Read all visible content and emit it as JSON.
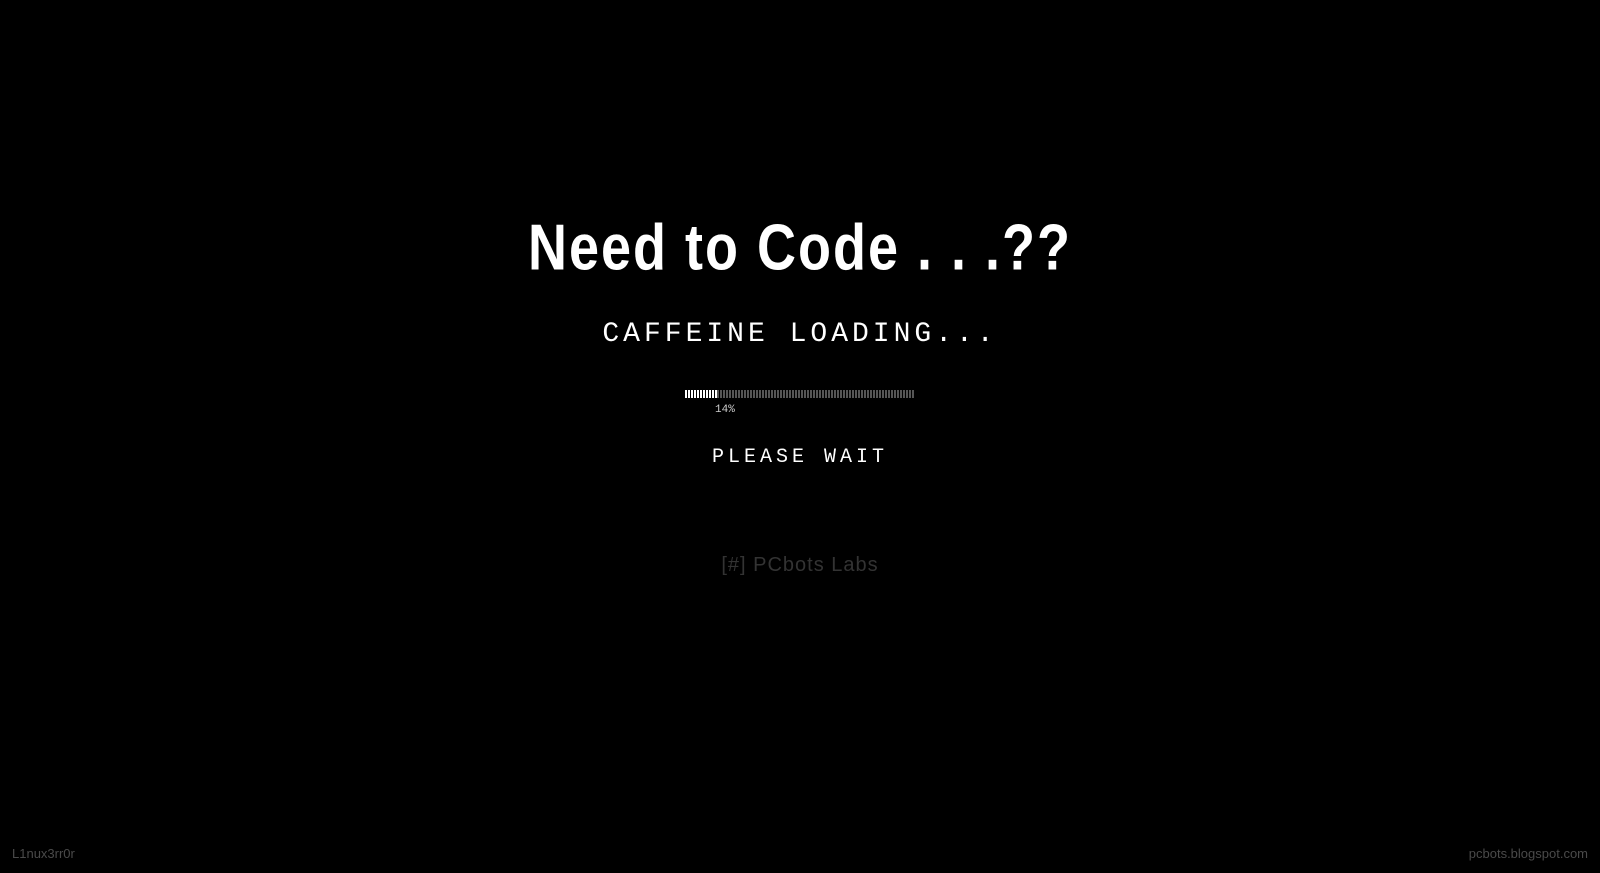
{
  "heading": "Need to Code . . .??",
  "loading_text": "CAFFEINE LOADING...",
  "progress": {
    "percent_value": 14,
    "percent_label": "14%"
  },
  "please_wait": "PLEASE WAIT",
  "credits": "[#] PCbots Labs",
  "footer": {
    "left": "L1nux3rr0r",
    "right": "pcbots.blogspot.com"
  }
}
